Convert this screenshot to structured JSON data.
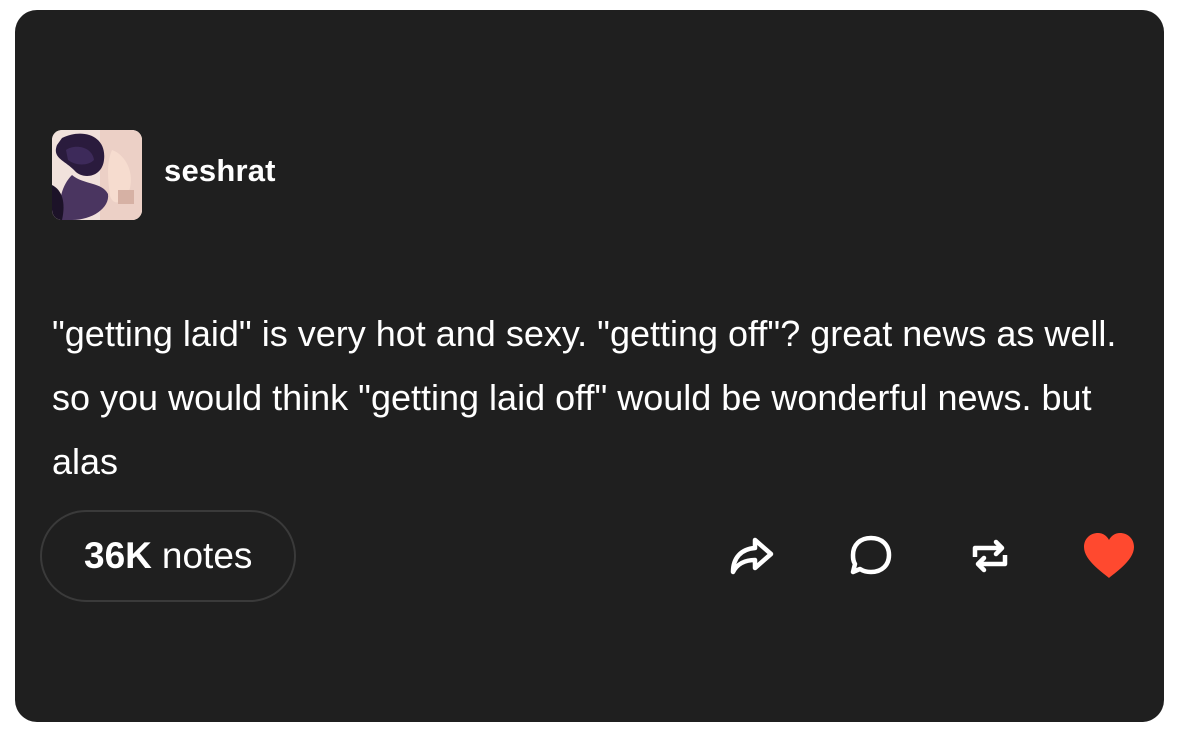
{
  "post": {
    "author": {
      "username": "seshrat"
    },
    "body": "\"getting laid\" is very hot and sexy. \"getting off\"? great news as well. so you would think \"getting laid off\" would be wonderful news. but alas",
    "notes": {
      "count": "36K",
      "label": "notes"
    }
  },
  "actions": {
    "icons": [
      "share-icon",
      "reply-icon",
      "reblog-icon",
      "like-icon"
    ]
  },
  "colors": {
    "card_background": "#1f1f1f",
    "text": "#ffffff",
    "like_active": "#ff492f",
    "icon": "#ffffff"
  }
}
